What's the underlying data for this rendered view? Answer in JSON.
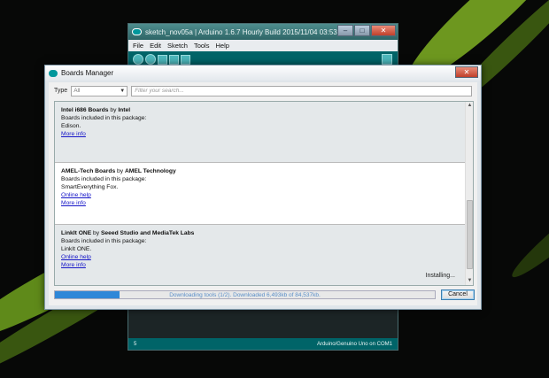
{
  "ide": {
    "title": "sketch_nov05a | Arduino 1.6.7 Hourly Build 2015/11/04 03:53",
    "menu": [
      "File",
      "Edit",
      "Sketch",
      "Tools",
      "Help"
    ],
    "status_line": "5",
    "status_board": "Arduino/Genuino Uno on COM1"
  },
  "dialog": {
    "title": "Boards Manager",
    "type_label": "Type",
    "type_value": "All",
    "search_placeholder": "Filter your search...",
    "entries": [
      {
        "name": "Intel i686 Boards",
        "by": " by ",
        "author": "Intel",
        "included_label": "Boards included in this package:",
        "boards": "Edison.",
        "more_info": "More info"
      },
      {
        "name": "AMEL-Tech Boards",
        "by": " by ",
        "author": "AMEL Technology",
        "included_label": "Boards included in this package:",
        "boards": "SmartEverything Fox.",
        "online_help": "Online help",
        "more_info": "More info"
      },
      {
        "name": "LinkIt ONE",
        "by": " by ",
        "author": "Seeed Studio and MediaTek Labs",
        "included_label": "Boards included in this package:",
        "boards": "LinkIt ONE.",
        "online_help": "Online help",
        "more_info": "More info"
      }
    ],
    "installing": "Installing...",
    "progress_text": "Downloading tools (1/2). Downloaded 6,493kb of 84,537kb.",
    "progress_fraction": 0.17,
    "cancel_label": "Cancel"
  }
}
